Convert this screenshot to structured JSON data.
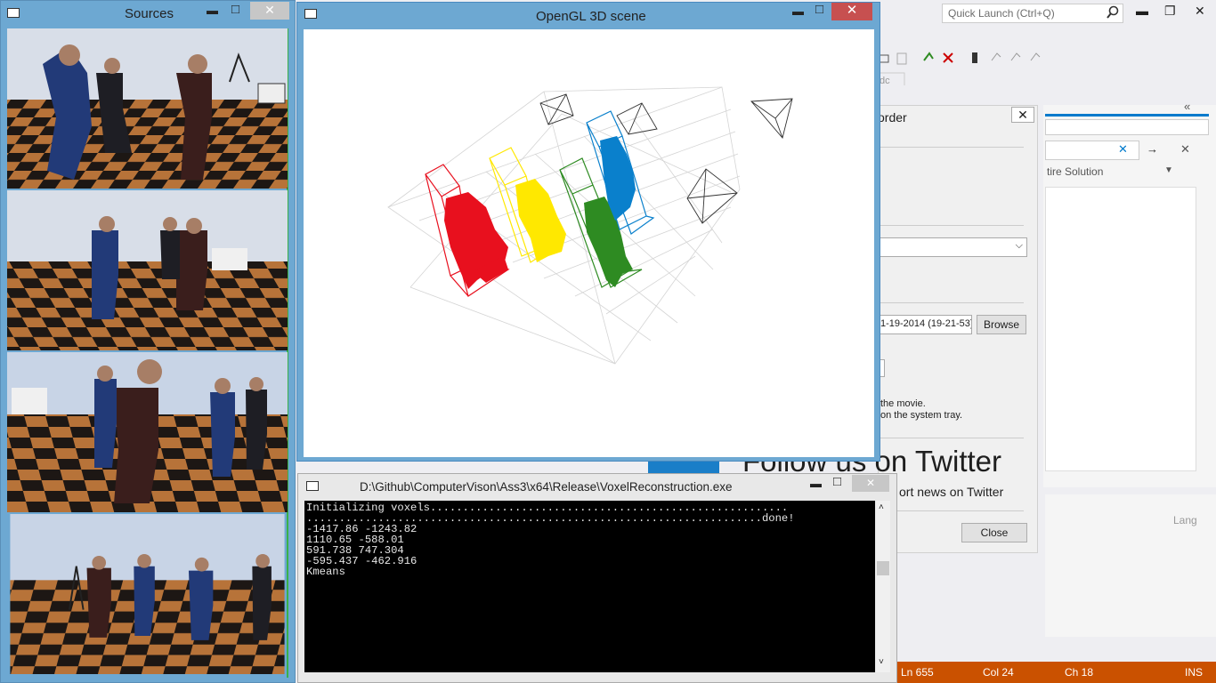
{
  "vs": {
    "quick_launch_placeholder": "Quick Launch (Ctrl+Q)",
    "entire_solution": "tire Solution",
    "lang": "Lang",
    "status": {
      "ln": "Ln 655",
      "col": "Col 24",
      "ch": "Ch 18",
      "ins": "INS"
    },
    "accent": "#ca5100"
  },
  "dialog": {
    "title": "order",
    "path_value": "1-19-2014 (19-21-53)",
    "browse_label": "Browse",
    "note1": "the movie.",
    "note2": "on the system tray.",
    "close_label": "Close",
    "twitter_heading": "Follow us on Twitter",
    "twitter_sub": "ort news on Twitter",
    "dc_label": "dc"
  },
  "sources": {
    "title": "Sources",
    "min": "▬",
    "max": "□",
    "close": "✕"
  },
  "gl": {
    "title": "OpenGL 3D scene",
    "min": "▬",
    "max": "□",
    "close": "✕",
    "colors": {
      "red": "#e8101e",
      "yellow": "#ffe800",
      "green": "#2e8b22",
      "blue": "#0a80cc"
    }
  },
  "console": {
    "title": "D:\\Github\\ComputerVison\\Ass3\\x64\\Release\\VoxelReconstruction.exe",
    "lines": [
      "Initializing voxels.......................................................",
      "......................................................................done!",
      "-1417.86 -1243.82",
      "1110.65 -588.01",
      "591.738 747.304",
      "-595.437 -462.916",
      "Kmeans"
    ],
    "min": "▬",
    "max": "□",
    "close": "✕"
  }
}
